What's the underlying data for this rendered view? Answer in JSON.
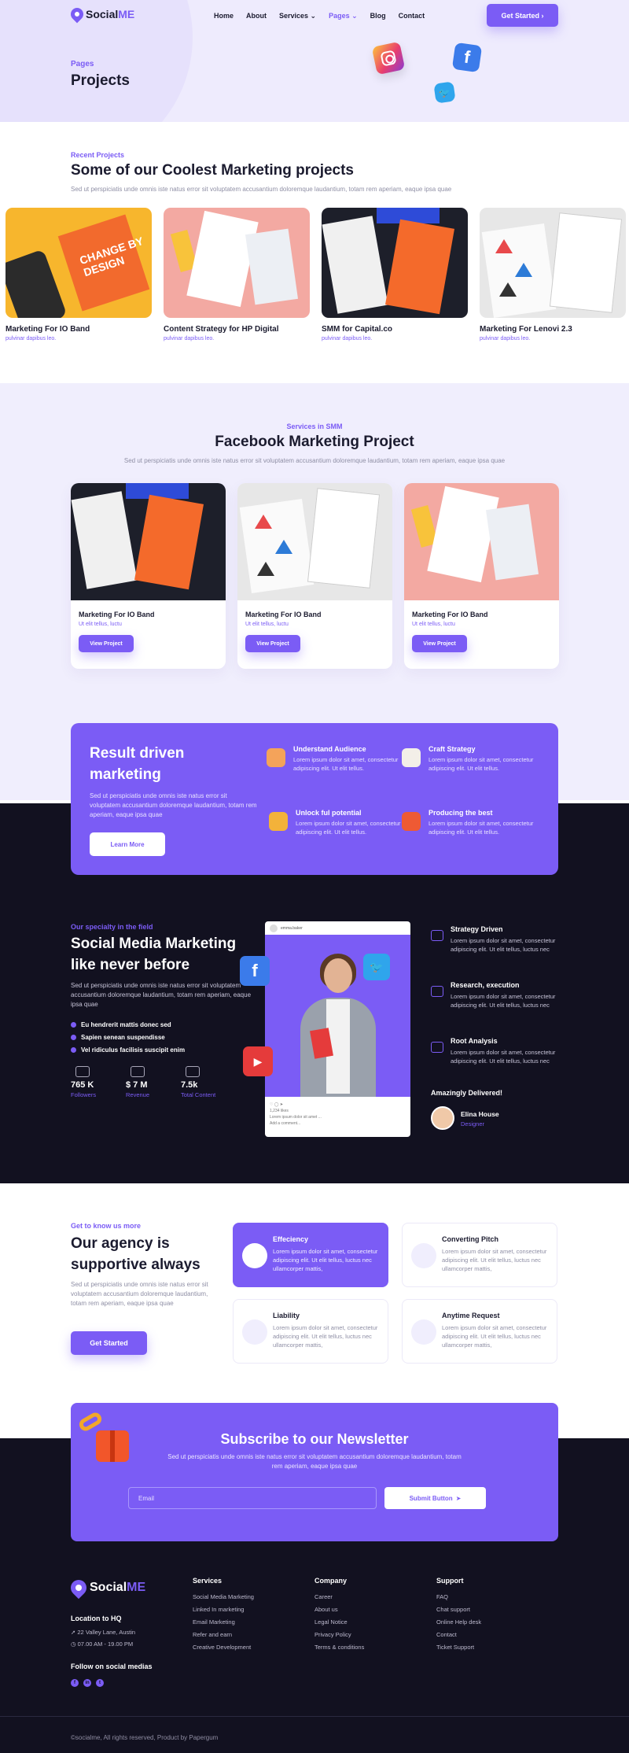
{
  "brand": {
    "name_main": "Social",
    "name_accent": "ME"
  },
  "nav": {
    "links": [
      "Home",
      "About",
      "Services ⌄",
      "Pages ⌄",
      "Blog",
      "Contact"
    ],
    "active": "Pages ⌄",
    "cta": "Get Started ›"
  },
  "hero": {
    "kicker": "Pages",
    "title": "Projects"
  },
  "recent": {
    "kicker": "Recent Projects",
    "title": "Some of our Coolest Marketing projects",
    "desc": "Sed ut perspiciatis unde omnis iste natus error sit voluptatem accusantium doloremque laudantium, totam rem aperiam, eaque ipsa quae",
    "cards": [
      {
        "title": "Marketing For IO Band",
        "sub": "pulvinar dapibus leo."
      },
      {
        "title": "Content Strategy for HP Digital",
        "sub": "pulvinar dapibus leo."
      },
      {
        "title": "SMM for Capital.co",
        "sub": "pulvinar dapibus leo."
      },
      {
        "title": "Marketing For Lenovi 2.3",
        "sub": "pulvinar dapibus leo."
      }
    ],
    "thumb_text": "CHANGE BY DESIGN"
  },
  "facebook": {
    "kicker": "Services in SMM",
    "title": "Facebook Marketing Project",
    "desc": "Sed ut perspiciatis unde omnis iste natus error sit voluptatem accusantium doloremque laudantium, totam rem aperiam, eaque ipsa quae",
    "cards": [
      {
        "title": "Marketing For IO Band",
        "sub": "Ut elit tellus, luctu",
        "button": "View Project"
      },
      {
        "title": "Marketing For IO Band",
        "sub": "Ut elit tellus, luctu",
        "button": "View Project"
      },
      {
        "title": "Marketing For IO Band",
        "sub": "Ut elit tellus, luctu",
        "button": "View Project"
      }
    ]
  },
  "result": {
    "title": "Result driven marketing",
    "desc": "Sed ut perspiciatis unde omnis iste natus error sit voluptatem accusantium doloremque laudantium, totam rem aperiam, eaque ipsa quae",
    "button": "Learn More",
    "features": [
      {
        "title": "Understand Audience",
        "desc": "Lorem ipsum dolor sit amet, consectetur adipiscing elit. Ut elit tellus."
      },
      {
        "title": "Craft Strategy",
        "desc": "Lorem ipsum dolor sit amet, consectetur adipiscing elit. Ut elit tellus."
      },
      {
        "title": "Unlock ful potential",
        "desc": "Lorem ipsum dolor sit amet, consectetur adipiscing elit. Ut elit tellus."
      },
      {
        "title": "Producing the best",
        "desc": "Lorem ipsum dolor sit amet, consectetur adipiscing elit. Ut elit tellus."
      }
    ]
  },
  "specialty": {
    "kicker": "Our specialty in the field",
    "title": "Social Media Marketing like never before",
    "desc": "Sed ut perspiciatis unde omnis iste natus error sit voluptatem accusantium doloremque laudantium, totam rem aperiam, eaque ipsa quae",
    "bullets": [
      "Eu hendrerit mattis donec sed",
      "Sapien senean suspendisse",
      "Vel ridiculus facilisis suscipit enim"
    ],
    "stats": [
      {
        "value": "765 K",
        "label": "Followers"
      },
      {
        "value": "$ 7 M",
        "label": "Revenue"
      },
      {
        "value": "7.5k",
        "label": "Total Content"
      }
    ],
    "phone": {
      "handle": "emma.baker",
      "likes": "1,234 likes",
      "caption": "Lorem ipsum dolor sit amet ...",
      "comment": "Add a comment..."
    },
    "services": [
      {
        "title": "Strategy Driven",
        "desc": "Lorem ipsum dolor sit amet, consectetur adipiscing elit. Ut elit tellus, luctus nec"
      },
      {
        "title": "Research, execution",
        "desc": "Lorem ipsum dolor sit amet, consectetur adipiscing elit. Ut elit tellus, luctus nec"
      },
      {
        "title": "Root Analysis",
        "desc": "Lorem ipsum dolor sit amet, consectetur adipiscing elit. Ut elit tellus, luctus nec"
      }
    ],
    "delivered": "Amazingly Delivered!",
    "testimonial": {
      "name": "Elina House",
      "role": "Designer"
    }
  },
  "agency": {
    "kicker": "Get to know us more",
    "title": "Our agency is supportive always",
    "desc": "Sed ut perspiciatis unde omnis iste natus error sit voluptatem accusantium doloremque laudantium, totam rem aperiam, eaque ipsa quae",
    "button": "Get Started",
    "cards": [
      {
        "title": "Effeciency",
        "desc": "Lorem ipsum dolor sit amet, consectetur adipiscing elit. Ut elit tellus, luctus nec ullamcorper mattis,"
      },
      {
        "title": "Converting Pitch",
        "desc": "Lorem ipsum dolor sit amet, consectetur adipiscing elit. Ut elit tellus, luctus nec ullamcorper mattis,"
      },
      {
        "title": "Liability",
        "desc": "Lorem ipsum dolor sit amet, consectetur adipiscing elit. Ut elit tellus, luctus nec ullamcorper mattis,"
      },
      {
        "title": "Anytime Request",
        "desc": "Lorem ipsum dolor sit amet, consectetur adipiscing elit. Ut elit tellus, luctus nec ullamcorper mattis,"
      }
    ]
  },
  "newsletter": {
    "title": "Subscribe to our Newsletter",
    "desc": "Sed ut perspiciatis unde omnis iste natus error sit voluptatem accusantium doloremque laudantium, totam rem aperiam, eaque ipsa quae",
    "placeholder": "Email",
    "button": "Submit Button"
  },
  "footer": {
    "location_title": "Location to HQ",
    "address": "22 Valley Lane, Austin",
    "hours": "07.00 AM - 19.00 PM",
    "follow": "Follow on social medias",
    "columns": [
      {
        "title": "Services",
        "links": [
          "Social Media Marketing",
          "Linked In marketing",
          "Email Marketing",
          "Refer and earn",
          "Creative Development"
        ]
      },
      {
        "title": "Company",
        "links": [
          "Career",
          "About us",
          "Legal Notice",
          "Privacy Policy",
          "Terms & conditions"
        ]
      },
      {
        "title": "Support",
        "links": [
          "FAQ",
          "Chat support",
          "Online Help desk",
          "Contact",
          "Ticket Support"
        ]
      }
    ],
    "copyright": "©socialme, All rights reserved, Product by Papergum"
  }
}
